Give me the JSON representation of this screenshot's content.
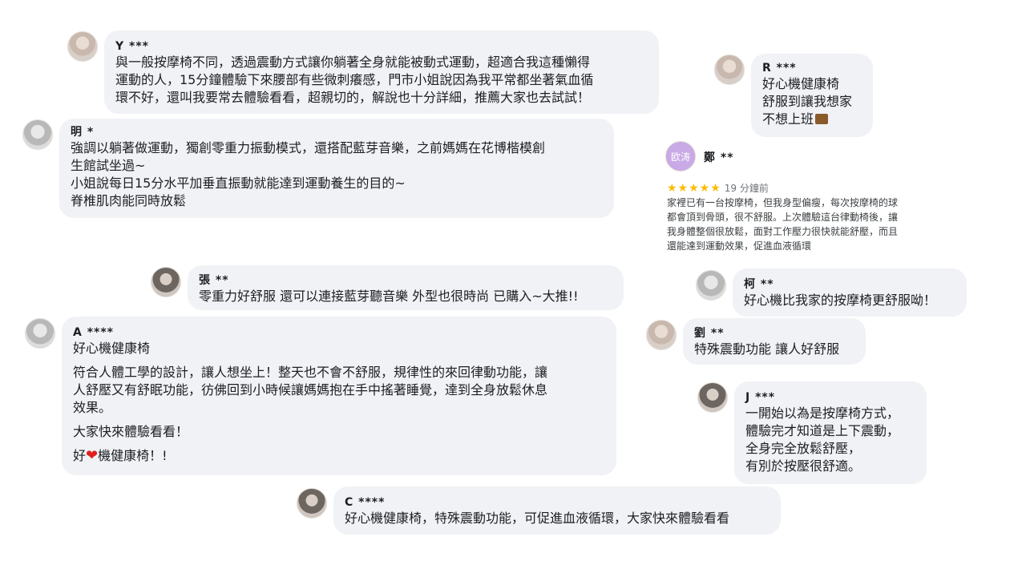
{
  "comments": {
    "y": {
      "name": "Y ***",
      "lines": [
        "與一般按摩椅不同，透過震動方式讓你躺著全身就能被動式運動，超適合我這種懶得\n運動的人，15分鐘體驗下來腰部有些微刺癢感，門市小姐說因為我平常都坐著氣血循\n環不好，還叫我要常去體驗看看，超親切的，解說也十分詳細，推薦大家也去試試！"
      ]
    },
    "ming": {
      "name": "明 *",
      "text": "強調以躺著做運動，獨創零重力振動模式，還搭配藍芽音樂，之前媽媽在花博楷模創\n生館試坐過~\n小姐說每日15分水平加垂直振動就能達到運動養生的目的~\n脊椎肌肉能同時放鬆"
    },
    "zhang": {
      "name": "張 **",
      "text": "零重力好舒服 還可以連接藍芽聽音樂 外型也很時尚 已購入~大推!!"
    },
    "a": {
      "name": "A ****",
      "title": "好心機健康椅",
      "para": "符合人體工學的設計，讓人想坐上！整天也不會不舒服，規律性的來回律動功能，讓\n人舒壓又有舒眠功能，彷佛回到小時候讓媽媽抱在手中搖著睡覺，達到全身放鬆休息\n效果。",
      "cta": "大家快來體驗看看！",
      "sign_prefix": "好",
      "heart": "❤",
      "sign_suffix": "機健康椅！!"
    },
    "c": {
      "name": "C ****",
      "text": "好心機健康椅，特殊震動功能，可促進血液循環，大家快來體驗看看"
    },
    "r": {
      "name": "R ***",
      "text": "好心機健康椅\n舒服到讓我想家\n不想上班"
    },
    "zheng": {
      "name": "鄭 **",
      "avatar_text": "欧涛",
      "stars": "★★★★★",
      "time": "19 分鐘前",
      "text": "家裡已有一台按摩椅，但我身型偏瘦，每次按摩椅的球\n都會頂到骨頭，很不舒服。上次體驗這台律動椅後，讓\n我身體整個很放鬆，面對工作壓力很快就能舒壓，而且\n還能達到運動效果，促進血液循環"
    },
    "ke": {
      "name": "柯 **",
      "text": "好心機比我家的按摩椅更舒服呦！"
    },
    "liu": {
      "name": "劉 **",
      "text": "特殊震動功能 讓人好舒服"
    },
    "j": {
      "name": "J ***",
      "text": "一開始以為是按摩椅方式，\n體驗完才知道是上下震動，\n全身完全放鬆舒壓，\n有別於按壓很舒適。"
    }
  }
}
